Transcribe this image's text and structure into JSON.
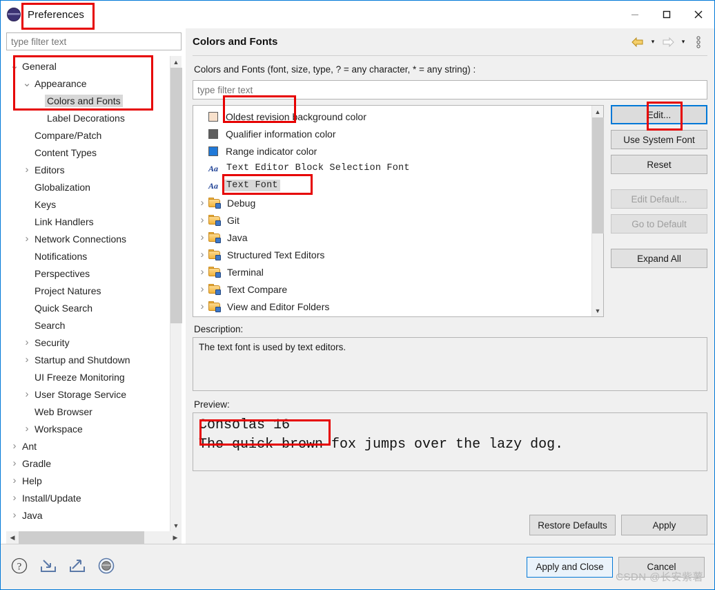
{
  "window": {
    "title": "Preferences",
    "icon": "eclipse-logo-icon",
    "minimize": "—",
    "maximize": "□",
    "close": "✕"
  },
  "sidebar": {
    "filter_placeholder": "type filter text",
    "items": [
      {
        "label": "General",
        "indent": 1,
        "twisty": "down",
        "selected": false
      },
      {
        "label": "Appearance",
        "indent": 2,
        "twisty": "down",
        "selected": false
      },
      {
        "label": "Colors and Fonts",
        "indent": 3,
        "twisty": "none",
        "selected": true
      },
      {
        "label": "Label Decorations",
        "indent": 3,
        "twisty": "none",
        "selected": false
      },
      {
        "label": "Compare/Patch",
        "indent": 2,
        "twisty": "none",
        "selected": false
      },
      {
        "label": "Content Types",
        "indent": 2,
        "twisty": "none",
        "selected": false
      },
      {
        "label": "Editors",
        "indent": 2,
        "twisty": "right",
        "selected": false
      },
      {
        "label": "Globalization",
        "indent": 2,
        "twisty": "none",
        "selected": false
      },
      {
        "label": "Keys",
        "indent": 2,
        "twisty": "none",
        "selected": false
      },
      {
        "label": "Link Handlers",
        "indent": 2,
        "twisty": "none",
        "selected": false
      },
      {
        "label": "Network Connections",
        "indent": 2,
        "twisty": "right",
        "selected": false
      },
      {
        "label": "Notifications",
        "indent": 2,
        "twisty": "none",
        "selected": false
      },
      {
        "label": "Perspectives",
        "indent": 2,
        "twisty": "none",
        "selected": false
      },
      {
        "label": "Project Natures",
        "indent": 2,
        "twisty": "none",
        "selected": false
      },
      {
        "label": "Quick Search",
        "indent": 2,
        "twisty": "none",
        "selected": false
      },
      {
        "label": "Search",
        "indent": 2,
        "twisty": "none",
        "selected": false
      },
      {
        "label": "Security",
        "indent": 2,
        "twisty": "right",
        "selected": false
      },
      {
        "label": "Startup and Shutdown",
        "indent": 2,
        "twisty": "right",
        "selected": false
      },
      {
        "label": "UI Freeze Monitoring",
        "indent": 2,
        "twisty": "none",
        "selected": false
      },
      {
        "label": "User Storage Service",
        "indent": 2,
        "twisty": "right",
        "selected": false
      },
      {
        "label": "Web Browser",
        "indent": 2,
        "twisty": "none",
        "selected": false
      },
      {
        "label": "Workspace",
        "indent": 2,
        "twisty": "right",
        "selected": false
      },
      {
        "label": "Ant",
        "indent": 1,
        "twisty": "right",
        "selected": false
      },
      {
        "label": "Gradle",
        "indent": 1,
        "twisty": "right",
        "selected": false
      },
      {
        "label": "Help",
        "indent": 1,
        "twisty": "right",
        "selected": false
      },
      {
        "label": "Install/Update",
        "indent": 1,
        "twisty": "right",
        "selected": false
      },
      {
        "label": "Java",
        "indent": 1,
        "twisty": "right",
        "selected": false
      }
    ]
  },
  "pane": {
    "title": "Colors and Fonts",
    "nav": {
      "back_icon": "back-arrow-icon",
      "back_caret": "▾",
      "forward_icon": "forward-arrow-icon",
      "forward_caret": "▾",
      "menu_icon": "view-menu-icon"
    },
    "description_line": "Colors and Fonts (font, size, type, ? = any character, * = any string) :",
    "filter_placeholder": "type filter text",
    "list": [
      {
        "label": "Oldest revision background color",
        "kind": "color",
        "color": "#f7e0cb",
        "indent": 2,
        "twisty": "none",
        "selected": false,
        "mono": false
      },
      {
        "label": "Qualifier information color",
        "kind": "color",
        "color": "#5e5e5e",
        "indent": 2,
        "twisty": "none",
        "selected": false,
        "mono": false
      },
      {
        "label": "Range indicator color",
        "kind": "color",
        "color": "#2079d8",
        "indent": 2,
        "twisty": "none",
        "selected": false,
        "mono": false
      },
      {
        "label": "Text Editor Block Selection Font",
        "kind": "font",
        "icon": "Aa",
        "indent": 2,
        "twisty": "none",
        "selected": false,
        "mono": true
      },
      {
        "label": "Text Font",
        "kind": "font",
        "icon": "Aa",
        "indent": 2,
        "twisty": "none",
        "selected": true,
        "mono": true
      },
      {
        "label": "Debug",
        "kind": "folder",
        "indent": 1,
        "twisty": "right",
        "selected": false,
        "mono": false
      },
      {
        "label": "Git",
        "kind": "folder",
        "indent": 1,
        "twisty": "right",
        "selected": false,
        "mono": false
      },
      {
        "label": "Java",
        "kind": "folder",
        "indent": 1,
        "twisty": "right",
        "selected": false,
        "mono": false
      },
      {
        "label": "Structured Text Editors",
        "kind": "folder",
        "indent": 1,
        "twisty": "right",
        "selected": false,
        "mono": false
      },
      {
        "label": "Terminal",
        "kind": "folder",
        "indent": 1,
        "twisty": "right",
        "selected": false,
        "mono": false
      },
      {
        "label": "Text Compare",
        "kind": "folder",
        "indent": 1,
        "twisty": "right",
        "selected": false,
        "mono": false
      },
      {
        "label": "View and Editor Folders",
        "kind": "folder",
        "indent": 1,
        "twisty": "right",
        "selected": false,
        "mono": false
      }
    ],
    "buttons": [
      {
        "label": "Edit...",
        "state": "focused"
      },
      {
        "label": "Use System Font",
        "state": "enabled"
      },
      {
        "label": "Reset",
        "state": "enabled"
      },
      {
        "label": "Edit Default...",
        "state": "disabled"
      },
      {
        "label": "Go to Default",
        "state": "disabled"
      },
      {
        "label": "Expand All",
        "state": "enabled"
      }
    ],
    "description_label": "Description:",
    "description_text": "The text font is used by text editors.",
    "preview_label": "Preview:",
    "preview_line1": "Consolas 16",
    "preview_line2": "The quick brown fox jumps over the lazy dog.",
    "restore_defaults": "Restore Defaults",
    "apply": "Apply"
  },
  "footer": {
    "help_icon": "help-question-icon",
    "import_icon": "import-icon",
    "export_icon": "export-icon",
    "oomph_icon": "oomph-record-icon",
    "apply_and_close": "Apply and Close",
    "cancel": "Cancel"
  },
  "watermark": "CSDN @长安紫薯",
  "colors": {
    "accent": "#0078d7",
    "annotation": "#e60000",
    "selection": "#d8d8d8"
  }
}
